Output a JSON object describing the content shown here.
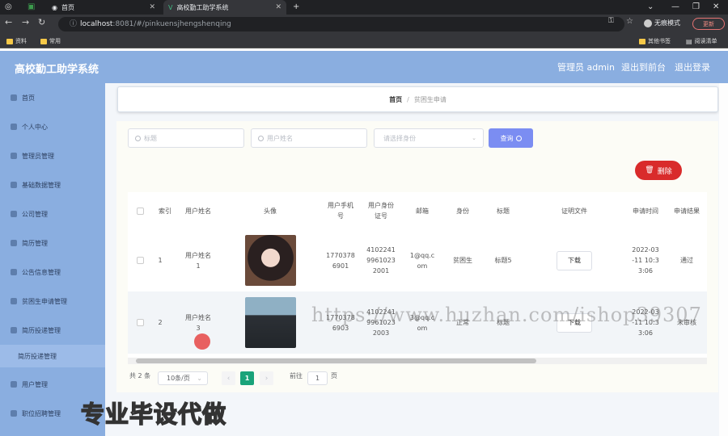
{
  "browser": {
    "tabs": [
      {
        "label": "首页"
      },
      {
        "label": "高校勤工助学系统"
      }
    ],
    "url_host": "localhost",
    "url_rest": ":8081/#/pinkuensjhengshenqing",
    "incognito_label": "无痕模式",
    "update_label": "更新",
    "bookmarks": [
      "资料",
      "常用"
    ],
    "bookmarks_right": [
      "其他书签",
      "阅读清单"
    ]
  },
  "app": {
    "title": "高校勤工助学系统",
    "admin_label": "管理员 admin",
    "back_label": "退出到前台",
    "logout_label": "退出登录"
  },
  "sidebar": {
    "items": [
      {
        "label": "首页",
        "icon": "home-icon"
      },
      {
        "label": "个人中心",
        "icon": "user-icon"
      },
      {
        "label": "管理员管理",
        "icon": "admin-icon"
      },
      {
        "label": "基础数据管理",
        "icon": "grid-icon"
      },
      {
        "label": "公司管理",
        "icon": "company-icon"
      },
      {
        "label": "简历管理",
        "icon": "resume-icon"
      },
      {
        "label": "公告信息管理",
        "icon": "notice-icon"
      },
      {
        "label": "贫困生申请管理",
        "icon": "apply-icon"
      },
      {
        "label": "简历投递管理",
        "icon": "send-icon"
      }
    ],
    "sub_item": "简历投递管理",
    "items_after": [
      {
        "label": "用户管理",
        "icon": "users-icon"
      },
      {
        "label": "职位招聘管理",
        "icon": "job-icon"
      }
    ]
  },
  "breadcrumb": {
    "home": "首页",
    "separator": "/",
    "current": "贫困生申请"
  },
  "search": {
    "title_placeholder": "标题",
    "name_placeholder": "用户姓名",
    "identity_placeholder": "请选择身份",
    "query_label": "查询"
  },
  "actions": {
    "delete_label": "删除"
  },
  "table": {
    "headers": [
      "索引",
      "用户姓名",
      "头像",
      "用户手机\n号",
      "用户身份\n证号",
      "邮箱",
      "身份",
      "标题",
      "证明文件",
      "申请时间",
      "申请结果"
    ],
    "rows": [
      {
        "index": "1",
        "name": "用户姓名\n1",
        "phone": "1770378\n6901",
        "idcard": "4102241\n9961023\n2001",
        "email": "1@qq.c\nom",
        "identity": "贫困生",
        "title": "标题5",
        "file": "下载",
        "time": "2022-03\n-11 10:3\n3:06",
        "result": "通过"
      },
      {
        "index": "2",
        "name": "用户姓名\n3",
        "phone": "1770378\n6903",
        "idcard": "4102241\n9961023\n2003",
        "email": "3@qq.c\nom",
        "identity": "正常",
        "title": "标题",
        "file": "下载",
        "time": "2022-03\n-11 10:3\n3:06",
        "result": "未审核"
      }
    ]
  },
  "pagination": {
    "total": "共 2 条",
    "page_size": "10条/页",
    "prev": "‹",
    "current": "1",
    "next": "›",
    "goto": "前往",
    "goto_value": "1",
    "page_suffix": "页"
  },
  "overlay": {
    "watermark": "https://www.huzhan.com/ishop39307",
    "promo": "专业毕设代做"
  },
  "colors": {
    "accent": "#8aaee0",
    "query": "#7b8df2",
    "delete": "#d92b2b",
    "page_active": "#1aa37a"
  }
}
